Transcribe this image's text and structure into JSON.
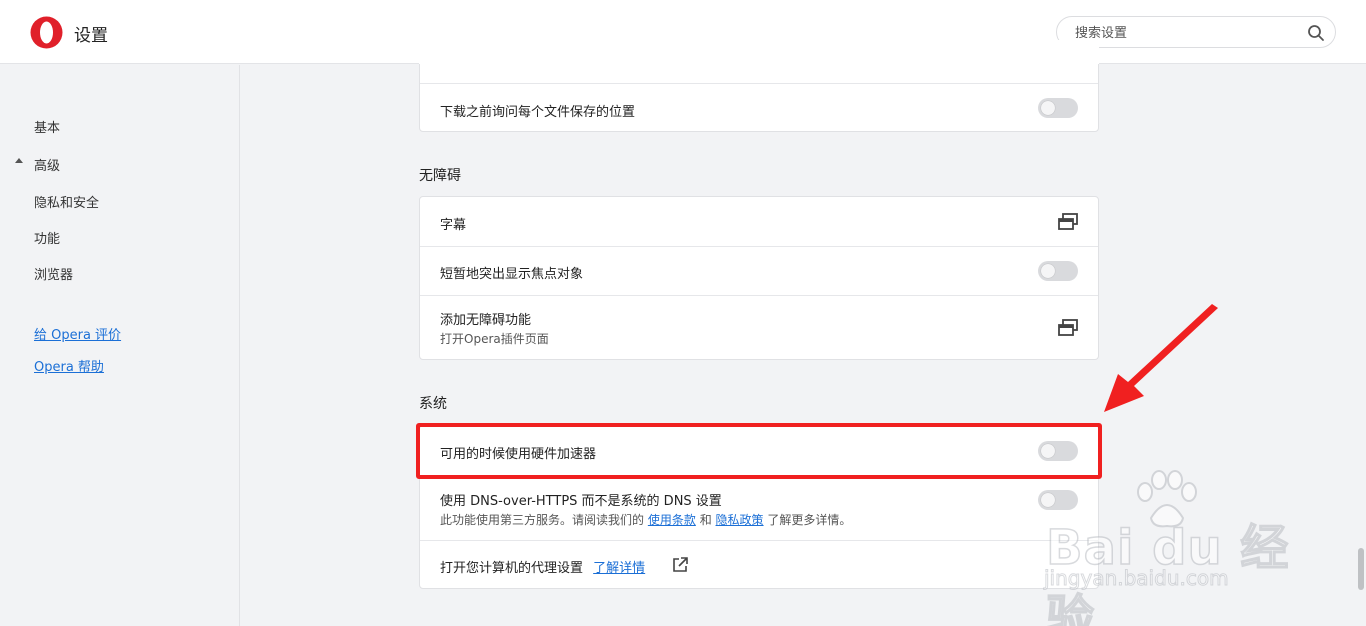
{
  "header": {
    "app_title": "设置",
    "search_placeholder": "搜索设置"
  },
  "sidebar": {
    "items": [
      {
        "label": "基本"
      },
      {
        "label": "高级"
      },
      {
        "label": "隐私和安全"
      },
      {
        "label": "功能"
      },
      {
        "label": "浏览器"
      }
    ],
    "links": [
      {
        "label": "给 Opera 评价"
      },
      {
        "label": "Opera 帮助"
      }
    ]
  },
  "downloads": {
    "ask_location_label": "下载之前询问每个文件保存的位置",
    "ask_location_on": false
  },
  "accessibility": {
    "title": "无障碍",
    "captions_label": "字幕",
    "focus_highlight_label": "短暂地突出显示焦点对象",
    "focus_highlight_on": false,
    "add_features_label": "添加无障碍功能",
    "add_features_sub": "打开Opera插件页面"
  },
  "system": {
    "title": "系统",
    "hw_accel_label": "可用的时候使用硬件加速器",
    "hw_accel_on": false,
    "doh_label": "使用 DNS-over-HTTPS 而不是系统的 DNS 设置",
    "doh_sub_pre": "此功能使用第三方服务。请阅读我们的",
    "doh_terms_link": "使用条款",
    "doh_and": "和",
    "doh_privacy_link": "隐私政策",
    "doh_sub_post": "了解更多详情。",
    "doh_on": false,
    "proxy_label": "打开您计算机的代理设置",
    "proxy_learn_more": "了解详情"
  },
  "watermark": {
    "main": "Bai du 经验",
    "sub": "jingyan.baidu.com"
  },
  "colors": {
    "accent_link": "#1b6fd6",
    "highlight": "#f02020",
    "opera_red": "#e0202a"
  }
}
